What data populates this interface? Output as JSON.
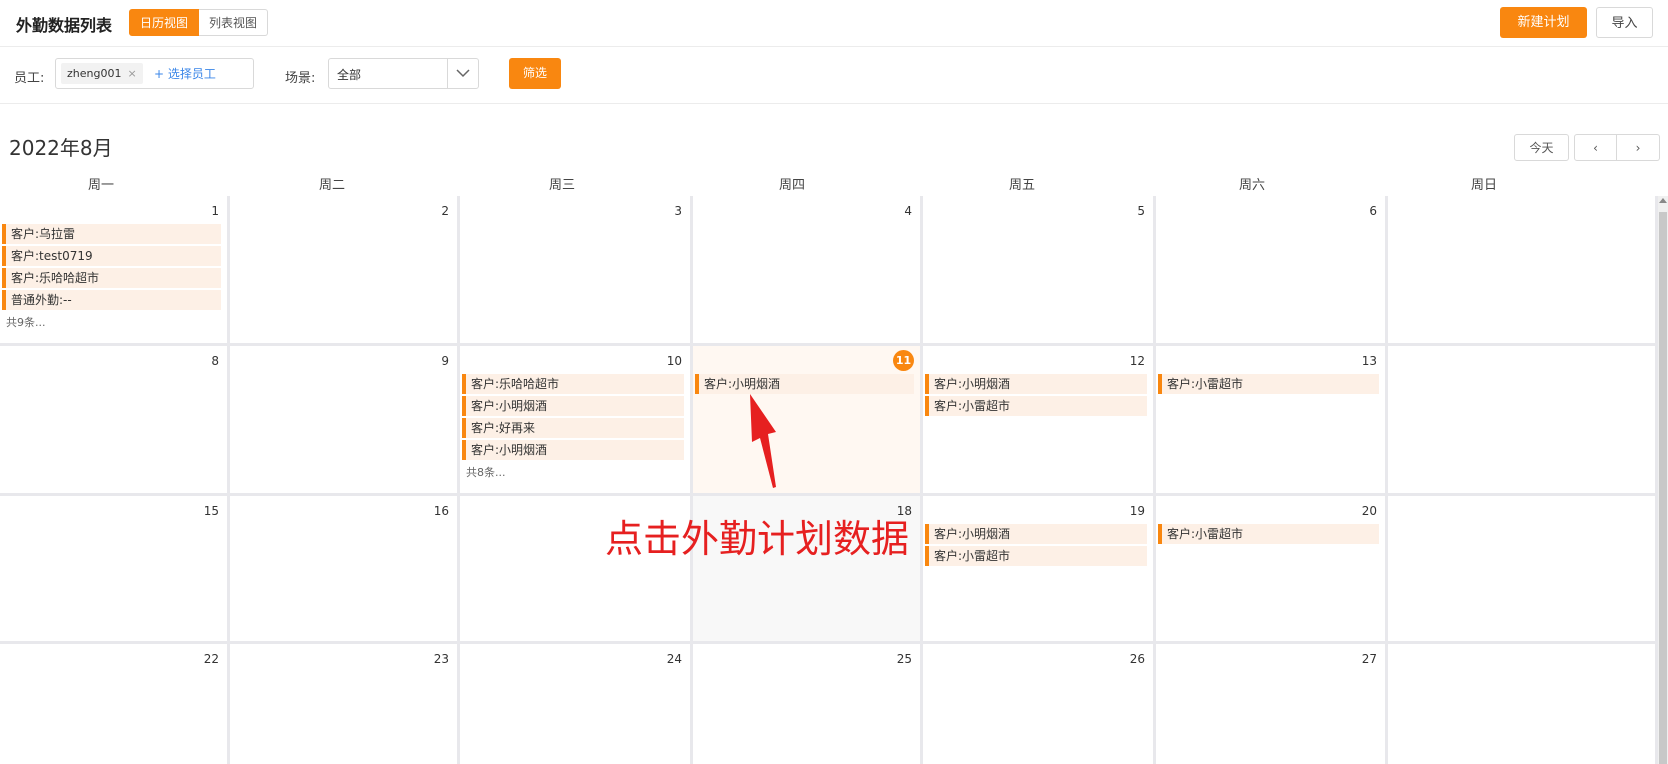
{
  "header": {
    "title": "外勤数据列表",
    "views": [
      "日历视图",
      "列表视图"
    ],
    "new_plan": "新建计划",
    "import": "导入"
  },
  "filters": {
    "employee_label": "员工:",
    "employee_tag": "zheng001",
    "tag_close": "×",
    "add_employee": "+ 选择员工",
    "scene_label": "场景:",
    "scene_value": "全部",
    "filter_button": "筛选"
  },
  "calendar": {
    "month_title": "2022年8月",
    "today_button": "今天",
    "prev": "‹",
    "next": "›",
    "weekdays": [
      "周一",
      "周二",
      "周三",
      "周四",
      "周五",
      "周六",
      "周日"
    ],
    "weeks": [
      [
        {
          "day": "1",
          "events": [
            "客户:乌拉雷",
            "客户:test0719",
            "客户:乐哈哈超市",
            "普通外勤:--"
          ],
          "more": "共9条..."
        },
        {
          "day": "2",
          "events": []
        },
        {
          "day": "3",
          "events": []
        },
        {
          "day": "4",
          "events": []
        },
        {
          "day": "5",
          "events": []
        },
        {
          "day": "6",
          "events": []
        },
        {
          "day": "",
          "events": []
        }
      ],
      [
        {
          "day": "8",
          "events": []
        },
        {
          "day": "9",
          "events": []
        },
        {
          "day": "10",
          "events": [
            "客户:乐哈哈超市",
            "客户:小明烟酒",
            "客户:好再来",
            "客户:小明烟酒"
          ],
          "more": "共8条..."
        },
        {
          "day": "11",
          "events": [
            "客户:小明烟酒"
          ],
          "today": true
        },
        {
          "day": "12",
          "events": [
            "客户:小明烟酒",
            "客户:小雷超市"
          ]
        },
        {
          "day": "13",
          "events": [
            "客户:小雷超市"
          ]
        },
        {
          "day": "",
          "events": []
        }
      ],
      [
        {
          "day": "15",
          "events": []
        },
        {
          "day": "16",
          "events": []
        },
        {
          "day": "",
          "events": []
        },
        {
          "day": "18",
          "events": [],
          "shade": true
        },
        {
          "day": "19",
          "events": [
            "客户:小明烟酒",
            "客户:小雷超市"
          ]
        },
        {
          "day": "20",
          "events": [
            "客户:小雷超市"
          ]
        },
        {
          "day": "",
          "events": []
        }
      ],
      [
        {
          "day": "22",
          "events": []
        },
        {
          "day": "23",
          "events": []
        },
        {
          "day": "24",
          "events": []
        },
        {
          "day": "25",
          "events": []
        },
        {
          "day": "26",
          "events": []
        },
        {
          "day": "27",
          "events": []
        },
        {
          "day": "",
          "events": []
        }
      ]
    ]
  },
  "annotation": {
    "text": "点击外勤计划数据"
  },
  "colors": {
    "accent": "#f98710",
    "event_bg": "#fdf0e6",
    "annotation": "#e62020"
  }
}
